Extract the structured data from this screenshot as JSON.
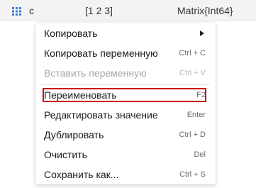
{
  "variable": {
    "icon": "matrix-grid-icon",
    "name": "c",
    "value": "[1 2 3]",
    "type": "Matrix{Int64}"
  },
  "context_menu": {
    "items": [
      {
        "label": "Копировать",
        "shortcut": "",
        "has_submenu": true,
        "enabled": true
      },
      {
        "label": "Копировать переменную",
        "shortcut": "Ctrl + C",
        "enabled": true
      },
      {
        "label": "Вставить переменную",
        "shortcut": "Ctrl + V",
        "enabled": false
      },
      {
        "label": "Переименовать",
        "shortcut": "F2",
        "enabled": true,
        "highlighted": true
      },
      {
        "label": "Редактировать значение",
        "shortcut": "Enter",
        "enabled": true
      },
      {
        "label": "Дублировать",
        "shortcut": "Ctrl + D",
        "enabled": true
      },
      {
        "label": "Очистить",
        "shortcut": "Del",
        "enabled": true
      },
      {
        "label": "Сохранить как...",
        "shortcut": "Ctrl + S",
        "enabled": true
      }
    ]
  },
  "colors": {
    "icon_blue": "#3d7bd9",
    "highlight_border": "#cc0000",
    "disabled_text": "#a7a7a7"
  }
}
